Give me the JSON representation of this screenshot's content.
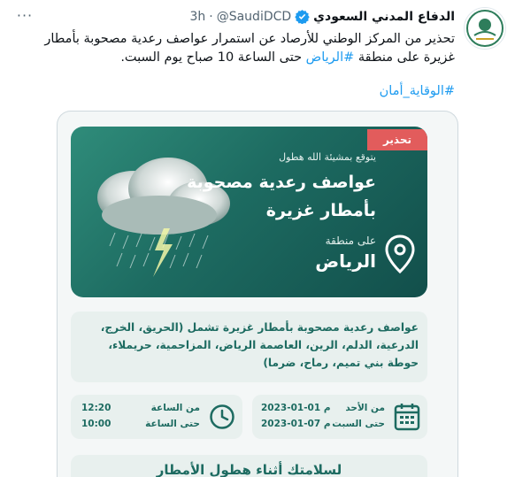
{
  "tweet": {
    "display_name": "الدفاع المدني السعودي",
    "handle": "@SaudiDCD",
    "separator": "·",
    "time": "3h",
    "more_label": "···",
    "text_part1": "تحذير من المركز الوطني للأرصاد عن استمرار عواصف رعدية مصحوبة بأمطار غزيرة على منطقة ",
    "hashtag_region": "#الرياض",
    "text_part2": " حتى الساعة 10 صباح يوم السبت.",
    "hashtag_safety": "#الوقاية_أمان"
  },
  "card": {
    "warning_tag": "تحذير",
    "subtitle": "يتوقع بمشيئة الله هطول",
    "title_line1": "عواصف رعدية مصحوبة",
    "title_line2": "بأمطار غزيرة",
    "region_label": "على منطقة",
    "region_name": "الرياض",
    "regions_text": "عواصف رعدية مصحوبة بأمطار غزيرة تشمل (الحريق، الخرج، الدرعية، الدلم، الرين، العاصمة الرياض، المزاحمية، حريملاء، حوطة بني تميم، رماح، ضرما)",
    "from_time_label": "من الساعة",
    "from_time": "12:20",
    "to_time_label": "حتى الساعة",
    "to_time": "10:00",
    "from_date_label": "من الأحد",
    "from_date": "2023-01-01 م",
    "to_date_label": "حتى السبت",
    "to_date": "2023-01-07 م",
    "bottom_title": "لسلامتك أثناء هطول الأمطار"
  },
  "colors": {
    "accent_blue": "#1d9bf0",
    "card_green": "#1d6b61",
    "warning_red": "#e25c5c"
  },
  "icons": [
    "more-icon",
    "verified-badge-icon",
    "avatar-logo",
    "storm-cloud-icon",
    "location-pin-icon",
    "clock-icon",
    "calendar-icon"
  ]
}
